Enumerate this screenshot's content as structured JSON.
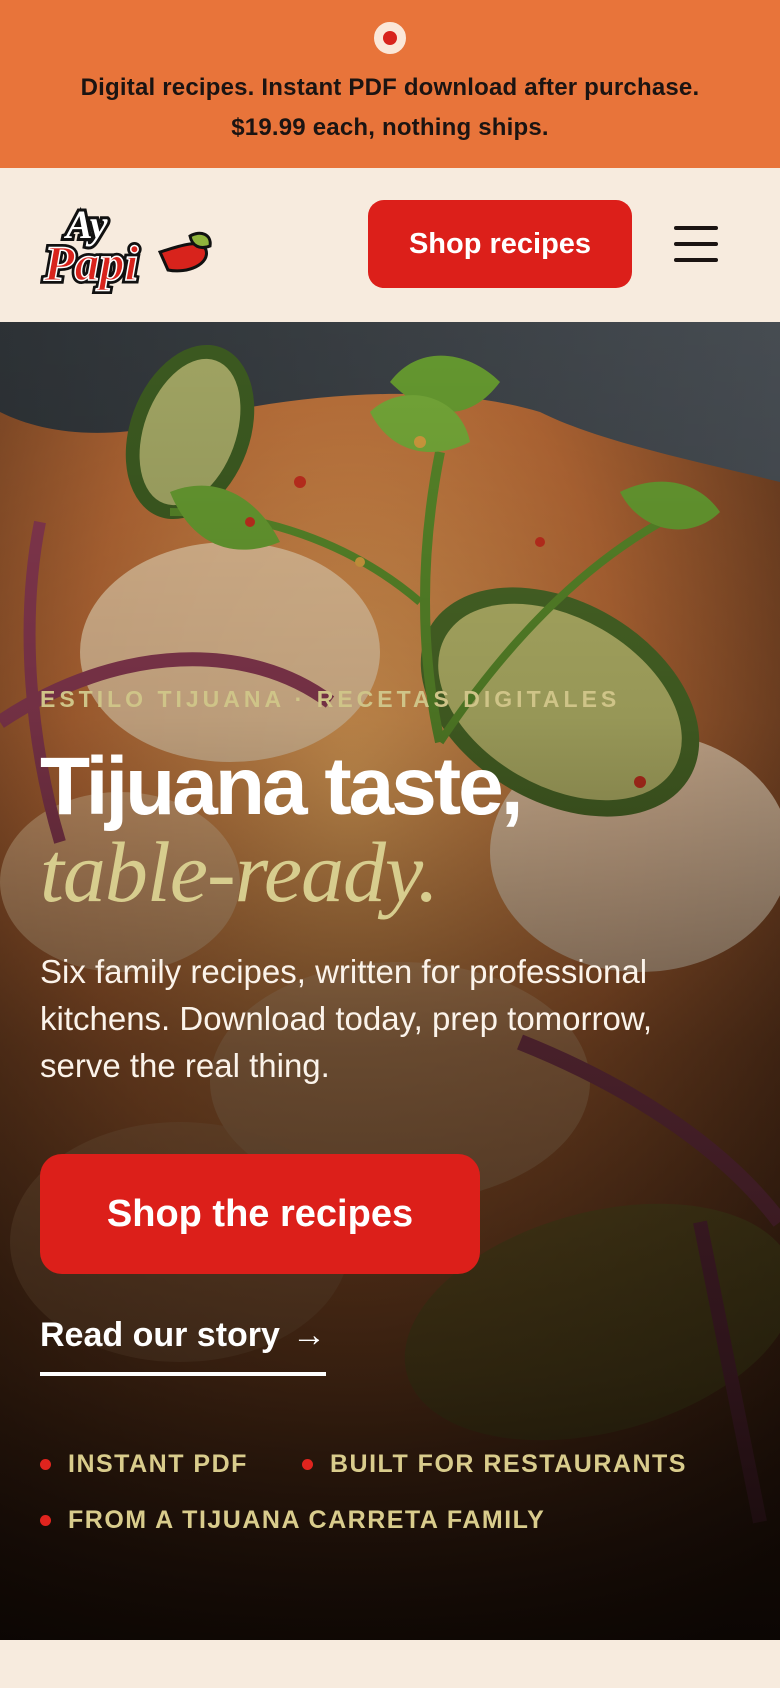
{
  "announcement": {
    "line1": "Digital recipes. Instant PDF download after purchase.",
    "line2": "$19.99 each, nothing ships."
  },
  "header": {
    "logo_top": "Ay",
    "logo_bottom": "Papi",
    "shop_button": "Shop recipes",
    "menu_icon": "hamburger-menu-icon"
  },
  "hero": {
    "eyebrow": "ESTILO TIJUANA · RECETAS DIGITALES",
    "headline": "Tijuana taste,",
    "headline_italic": "table-ready.",
    "lead": "Six family recipes, written for professional kitchens. Download today, prep tomorrow, serve the real thing.",
    "cta": "Shop the recipes",
    "story_link": "Read our story",
    "story_arrow": "→",
    "features": [
      "INSTANT PDF",
      "BUILT FOR RESTAURANTS",
      "FROM A TIJUANA CARRETA FAMILY"
    ]
  },
  "colors": {
    "announcement_bg": "#e8743a",
    "brand_red": "#dc1f1a",
    "cream": "#f7ebde",
    "accent_gold": "#d7cd8e"
  }
}
